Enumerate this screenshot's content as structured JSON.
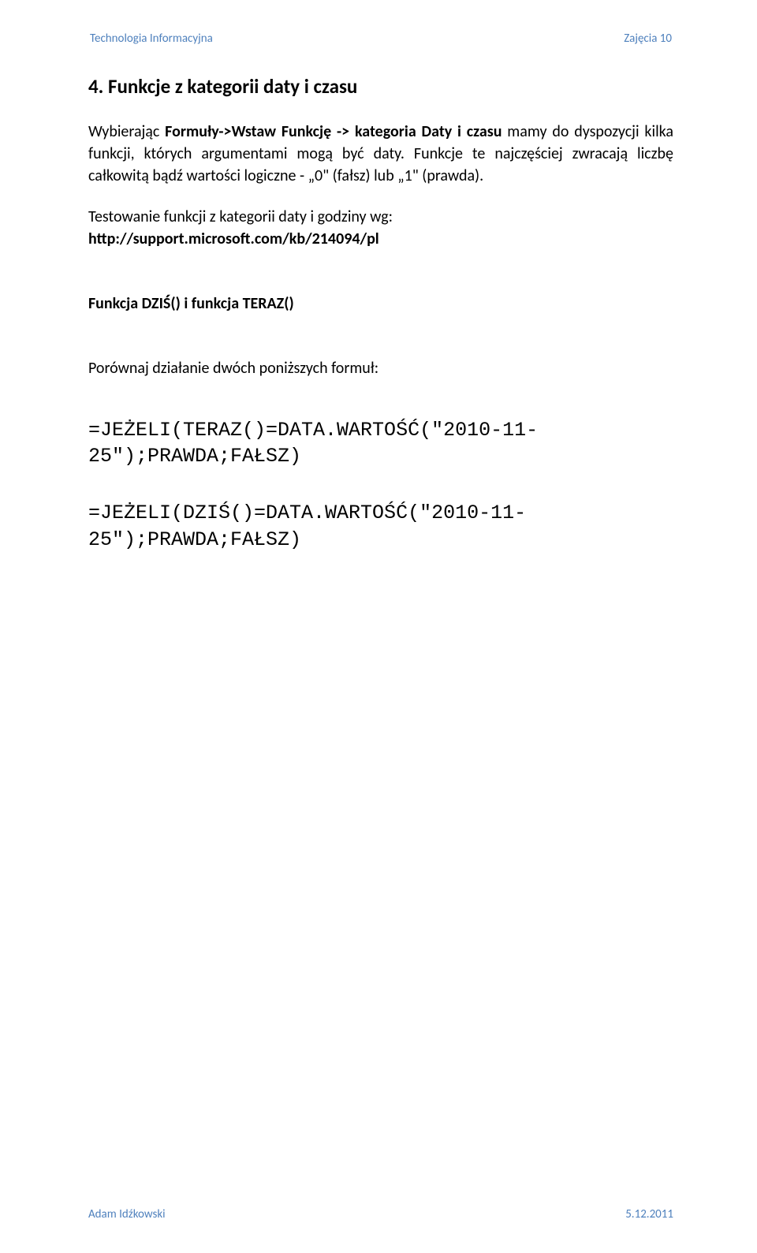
{
  "header": {
    "left": "Technologia Informacyjna",
    "right": "Zajęcia 10"
  },
  "footer": {
    "left": "Adam Idźkowski",
    "right": "5.12.2011"
  },
  "section": {
    "heading": "4. Funkcje z kategorii daty i czasu",
    "para1_pre": "Wybierając ",
    "para1_bold": "Formuły->Wstaw Funkcję -> kategoria Daty i czasu",
    "para1_post": " mamy do dyspozycji kilka funkcji, których argumentami mogą być daty. Funkcje te najczęściej zwracają liczbę całkowitą bądź wartości logiczne - „0\" (fałsz) lub „1\" (prawda).",
    "para2_line1": "Testowanie funkcji z kategorii daty i godziny wg:",
    "para2_link": "http://support.microsoft.com/kb/214094/pl",
    "sub_heading": "Funkcja DZIŚ() i funkcja TERAZ()",
    "instr": "Porównaj działanie dwóch poniższych formuł:",
    "code1": "=JEŻELI(TERAZ()=DATA.WARTOŚĆ(\"2010-11-25\");PRAWDA;FAŁSZ)",
    "code2": "=JEŻELI(DZIŚ()=DATA.WARTOŚĆ(\"2010-11-25\");PRAWDA;FAŁSZ)"
  }
}
